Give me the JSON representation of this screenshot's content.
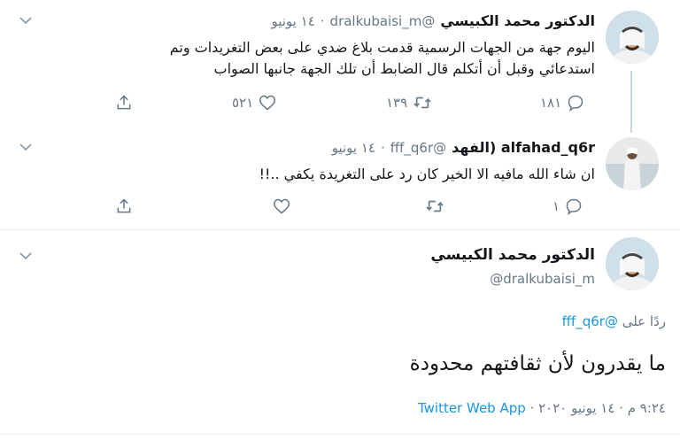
{
  "tweets": [
    {
      "name": "الدكتور محمد الكبيسي",
      "handle": "@dralkubaisi_m",
      "dot": "·",
      "date": "١٤ يونيو",
      "text_lines": [
        "اليوم جهة من الجهات الرسمية قدمت بلاغ ضدي على بعض التغريدات وتم",
        "استدعائي وقبل أن أتكلم قال الضابط أن تلك الجهة جانبها الصواب"
      ],
      "replies": "١٨١",
      "retweets": "١٣٩",
      "likes": "٥٢١"
    },
    {
      "name": "alfahad_q6r (الفهد",
      "handle": "@fff_q6r",
      "dot": "·",
      "date": "١٤ يونيو",
      "text_lines": [
        "ان شاء الله مافيه الا الخير كان رد على التغريدة يكفي ..!!"
      ],
      "replies": "١",
      "retweets": "",
      "likes": ""
    }
  ],
  "main_tweet": {
    "name": "الدكتور محمد الكبيسي",
    "handle": "@dralkubaisi_m",
    "reply_prefix": "ردًا على",
    "reply_to": "@fff_q6r",
    "text": "ما يقدرون لأن ثقافتهم محدودة",
    "timestamp": "٩:٢٤ م · ١٤ يونيو ٢٠٢٠",
    "separator": "·",
    "source": "Twitter Web App"
  },
  "icons": {
    "caret": "chevron-down-icon",
    "reply": "reply-icon",
    "retweet": "retweet-icon",
    "like": "heart-icon",
    "share": "share-icon"
  },
  "colors": {
    "link": "#1b95e0",
    "muted": "#657786",
    "text": "#14171a",
    "divider": "#e6ecf0"
  }
}
